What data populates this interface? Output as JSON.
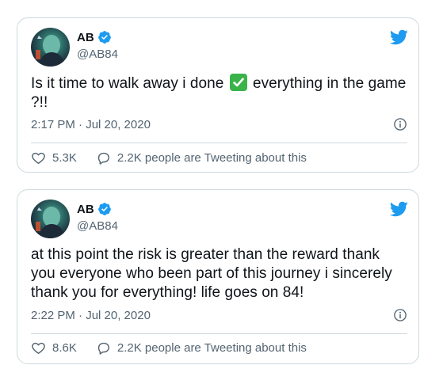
{
  "colors": {
    "twitter_blue": "#1d9bf0",
    "border": "#cfd9de",
    "secondary_text": "#536471",
    "checkmark_green": "#3ab44a"
  },
  "tweets": [
    {
      "name": "AB",
      "handle": "@AB84",
      "text_before": "Is it time to walk away i done ",
      "emoji_icon": "white-heavy-check-mark",
      "text_after": " everything in the game ?!!",
      "timestamp": "2:17 PM · Jul 20, 2020",
      "likes": "5.3K",
      "people_tweeting": "2.2K people are Tweeting about this"
    },
    {
      "name": "AB",
      "handle": "@AB84",
      "text": "at this point the risk is greater than the reward thank you everyone who been part of this journey i sincerely thank you for everything! life goes on 84!",
      "timestamp": "2:22 PM · Jul 20, 2020",
      "likes": "8.6K",
      "people_tweeting": "2.2K people are Tweeting about this"
    }
  ]
}
